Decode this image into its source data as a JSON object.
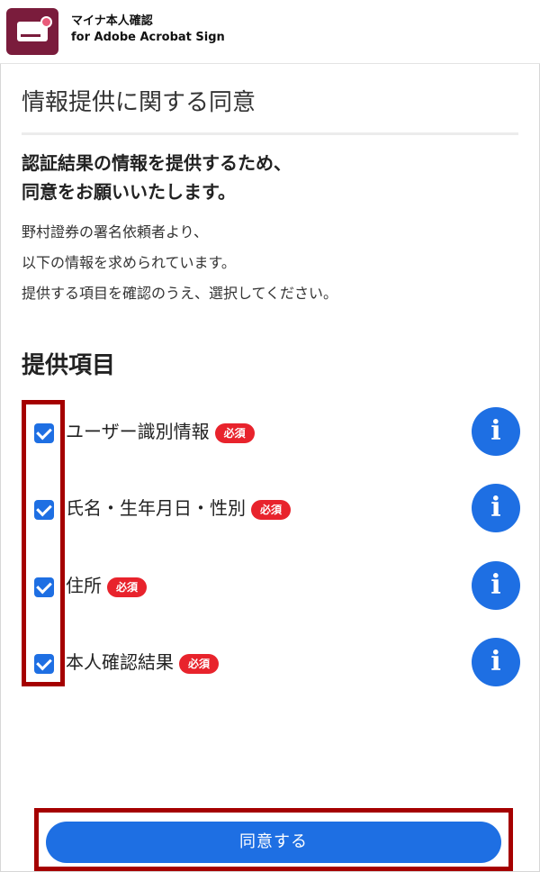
{
  "app": {
    "title_line1": "マイナ本人確認",
    "title_line2": "for Adobe Acrobat Sign"
  },
  "page": {
    "title": "情報提供に関する同意",
    "lead_line1": "認証結果の情報を提供するため、",
    "lead_line2": "同意をお願いいたします。",
    "desc_line1": "野村證券の署名依頼者より、",
    "desc_line2": "以下の情報を求められています。",
    "desc_line3": "提供する項目を確認のうえ、選択してください。"
  },
  "section": {
    "title": "提供項目"
  },
  "items": [
    {
      "label": "ユーザー識別情報",
      "badge": "必須",
      "checked": true
    },
    {
      "label": "氏名・生年月日・性別",
      "badge": "必須",
      "checked": true
    },
    {
      "label": "住所",
      "badge": "必須",
      "checked": true
    },
    {
      "label": "本人確認結果",
      "badge": "必須",
      "checked": true
    }
  ],
  "info_icon": "i",
  "submit": {
    "label": "同意する"
  },
  "colors": {
    "primary": "#1e6fe3",
    "badge": "#e8232c",
    "logo": "#7a1c3c",
    "highlight": "#a50000"
  }
}
